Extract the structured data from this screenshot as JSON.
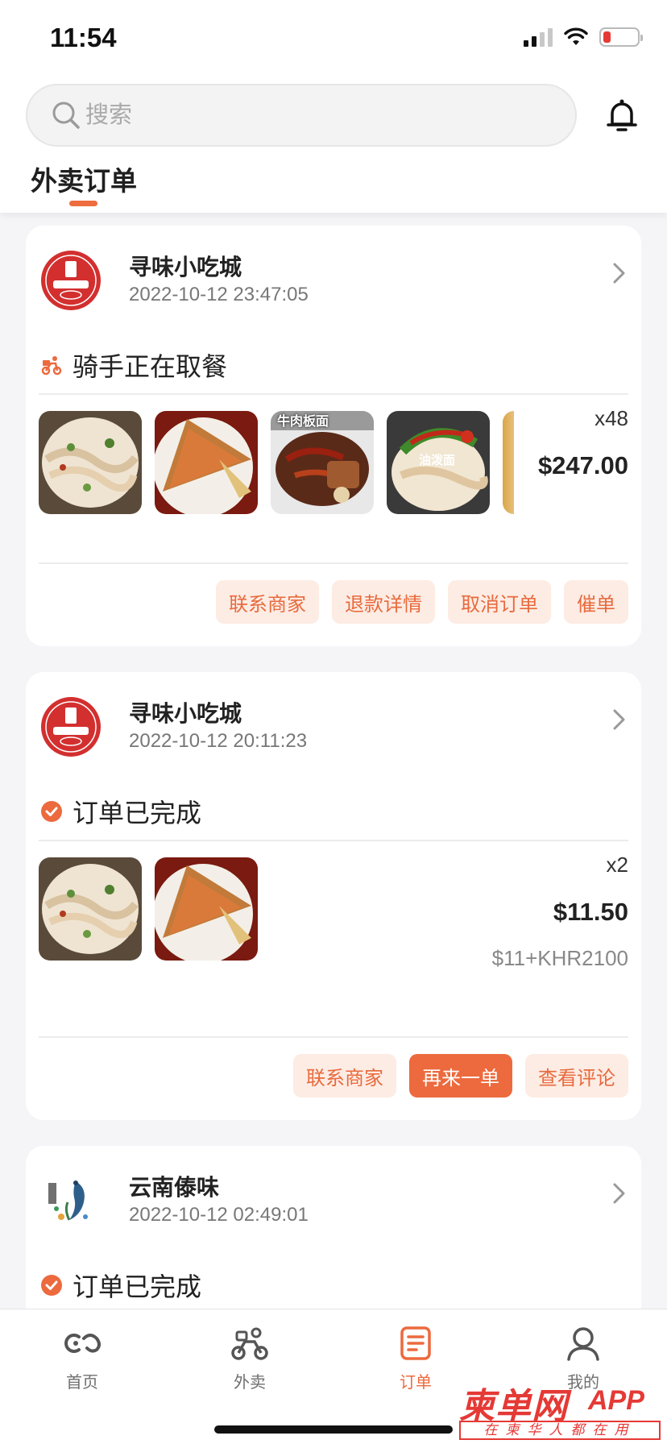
{
  "status_bar": {
    "time": "11:54"
  },
  "search": {
    "placeholder": "搜索"
  },
  "tab": {
    "title": "外卖订单"
  },
  "orders": [
    {
      "shop_name": "寻味小吃城",
      "order_time": "2022-10-12 23:47:05",
      "status": "骑手正在取餐",
      "status_icon": "rider-icon",
      "food_captions": [
        "牛肉板面",
        "油泼面"
      ],
      "quantity": "x48",
      "price": "$247.00",
      "buttons": [
        "联系商家",
        "退款详情",
        "取消订单",
        "催单"
      ]
    },
    {
      "shop_name": "寻味小吃城",
      "order_time": "2022-10-12 20:11:23",
      "status": "订单已完成",
      "status_icon": "check-circle-icon",
      "quantity": "x2",
      "price": "$11.50",
      "sub_price": "$11+KHR2100",
      "buttons": [
        "联系商家",
        "再来一单",
        "查看评论"
      ]
    },
    {
      "shop_name": "云南傣味",
      "order_time": "2022-10-12 02:49:01",
      "status": "订单已完成",
      "status_icon": "check-circle-icon"
    }
  ],
  "bottom_nav": [
    {
      "label": "首页",
      "icon": "home-icon"
    },
    {
      "label": "外卖",
      "icon": "scooter-icon"
    },
    {
      "label": "订单",
      "icon": "orders-icon",
      "active": true
    },
    {
      "label": "我的",
      "icon": "profile-icon"
    }
  ],
  "watermark": {
    "title": "柬单网",
    "app": "APP",
    "subtitle": "在柬华人都在用"
  },
  "colors": {
    "accent": "#ec6a3e",
    "accent_light": "#fdece4",
    "background": "#f5f5f7"
  }
}
